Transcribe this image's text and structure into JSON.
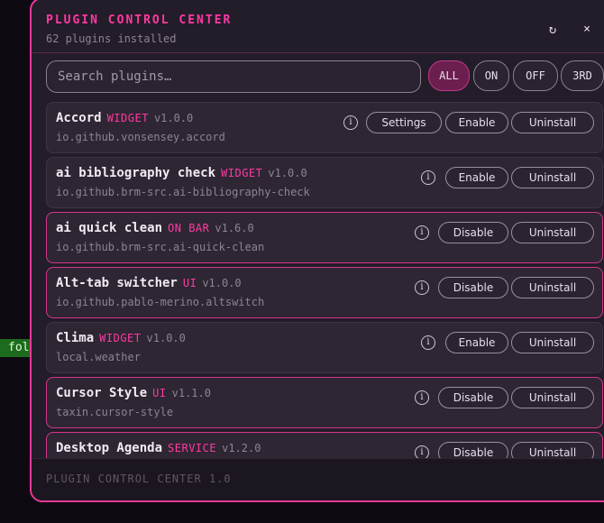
{
  "background": {
    "terminal_fragment": "fol"
  },
  "header": {
    "title": "PLUGIN CONTROL CENTER",
    "subtitle": "62 plugins installed",
    "refresh_icon": "↻",
    "close_icon": "×"
  },
  "search": {
    "placeholder": "Search plugins…",
    "value": ""
  },
  "filters": [
    {
      "label": "ALL",
      "active": true
    },
    {
      "label": "ON",
      "active": false
    },
    {
      "label": "OFF",
      "active": false
    },
    {
      "label": "3RD",
      "active": false
    }
  ],
  "plugins": [
    {
      "name": "Accord",
      "type": "WIDGET",
      "version": "v1.0.0",
      "id": "io.github.vonsensey.accord",
      "enabled": false,
      "settings": "Settings",
      "toggle": "Enable",
      "uninstall": "Uninstall"
    },
    {
      "name": "ai bibliography check",
      "type": "WIDGET",
      "version": "v1.0.0",
      "id": "io.github.brm-src.ai-bibliography-check",
      "enabled": false,
      "toggle": "Enable",
      "uninstall": "Uninstall"
    },
    {
      "name": "ai quick clean",
      "type": "ON BAR",
      "version": "v1.6.0",
      "id": "io.github.brm-src.ai-quick-clean",
      "enabled": true,
      "toggle": "Disable",
      "uninstall": "Uninstall"
    },
    {
      "name": "Alt-tab switcher",
      "type": "UI",
      "version": "v1.0.0",
      "id": "io.github.pablo-merino.altswitch",
      "enabled": true,
      "toggle": "Disable",
      "uninstall": "Uninstall"
    },
    {
      "name": "Clima",
      "type": "WIDGET",
      "version": "v1.0.0",
      "id": "local.weather",
      "enabled": false,
      "toggle": "Enable",
      "uninstall": "Uninstall"
    },
    {
      "name": "Cursor Style",
      "type": "UI",
      "version": "v1.1.0",
      "id": "taxin.cursor-style",
      "enabled": true,
      "toggle": "Disable",
      "uninstall": "Uninstall"
    },
    {
      "name": "Desktop Agenda",
      "type": "SERVICE",
      "version": "v1.2.0",
      "id": "",
      "enabled": true,
      "toggle": "Disable",
      "uninstall": "Uninstall"
    }
  ],
  "footer": {
    "text": "PLUGIN CONTROL CENTER 1.0"
  }
}
